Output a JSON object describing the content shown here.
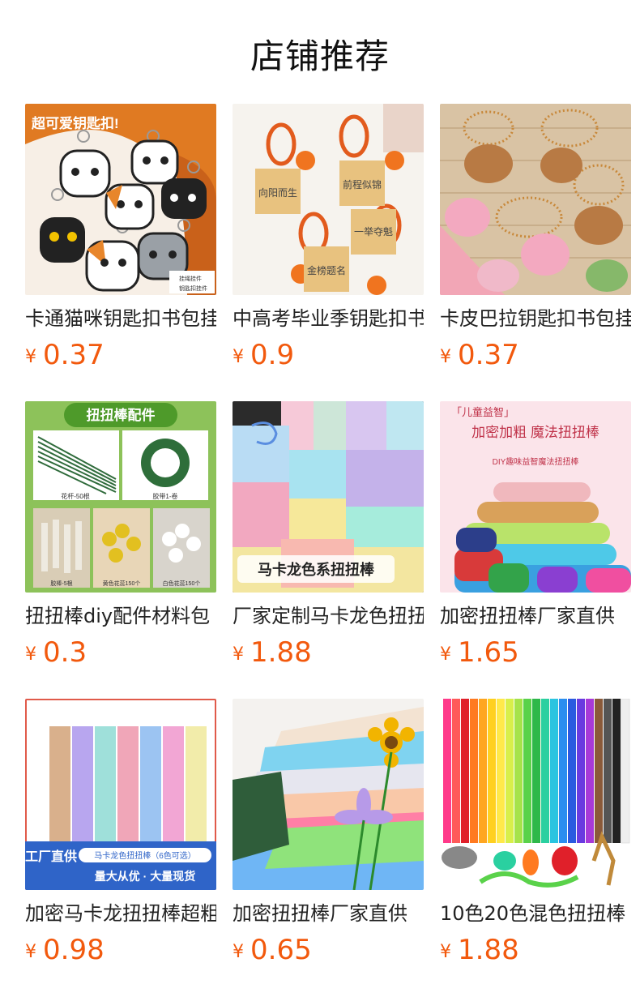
{
  "header": {
    "title": "店铺推荐"
  },
  "products": [
    {
      "title": "卡通猫咪钥匙扣书包挂件",
      "currency": "¥",
      "price": "0.37",
      "image_texts": [
        "超可爱钥匙扣!",
        "挂绳挂件",
        "钥匙扣挂件"
      ]
    },
    {
      "title": "中高考毕业季钥匙扣书包挂件",
      "currency": "¥",
      "price": "0.9",
      "image_texts": [
        "向阳而生",
        "前程似锦",
        "一举夺魁",
        "金榜题名"
      ]
    },
    {
      "title": "卡皮巴拉钥匙扣书包挂件",
      "currency": "¥",
      "price": "0.37",
      "image_texts": []
    },
    {
      "title": "扭扭棒diy配件材料包",
      "currency": "¥",
      "price": "0.3",
      "image_texts": [
        "扭扭棒配件",
        "花杆-50根",
        "胶带1-卷",
        "胶棒-5根",
        "黄色花蕊150个",
        "白色花蕊150个"
      ]
    },
    {
      "title": "厂家定制马卡龙色扭扭棒",
      "currency": "¥",
      "price": "1.88",
      "image_texts": [
        "马卡龙色系扭扭棒"
      ]
    },
    {
      "title": "加密扭扭棒厂家直供",
      "currency": "¥",
      "price": "1.65",
      "image_texts": [
        "「儿童益智」",
        "加密加粗 魔法扭扭棒",
        "DIY趣味益智魔法扭扭棒"
      ]
    },
    {
      "title": "加密马卡龙扭扭棒超粗",
      "currency": "¥",
      "price": "0.98",
      "image_texts": [
        "工厂直供",
        "马卡龙色扭扭棒（6色可选）",
        "量大从优 · 大量现货"
      ]
    },
    {
      "title": "加密扭扭棒厂家直供",
      "currency": "¥",
      "price": "0.65",
      "image_texts": []
    },
    {
      "title": "10色20色混色扭扭棒",
      "currency": "¥",
      "price": "1.88",
      "image_texts": []
    }
  ]
}
